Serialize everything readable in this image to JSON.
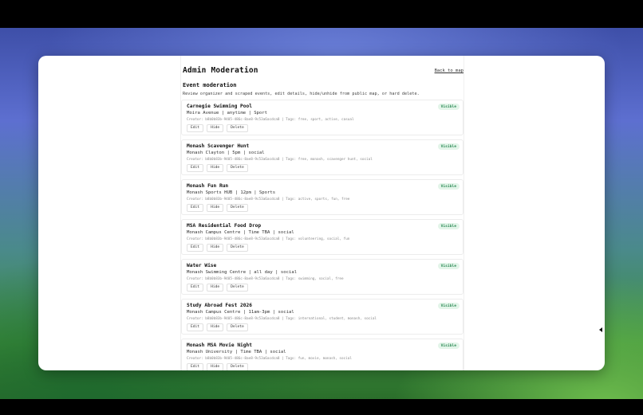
{
  "header": {
    "title": "Admin Moderation",
    "back_link": "Back to map"
  },
  "section": {
    "title": "Event moderation",
    "description": "Review organizer and scraped events, edit details, hide/unhide from public map, or hard delete."
  },
  "actions": {
    "edit": "Edit",
    "hide": "Hide",
    "delete": "Delete"
  },
  "events": [
    {
      "name": "Carnegie Swimming Pool",
      "meta": "Moira Avenue | anytime | Sport",
      "creator": "Creator: b8b0b83b-9405-486c-8ae8-9c53a6acdca8 | Tags: free, sport, active, casual",
      "status": "Visible"
    },
    {
      "name": "Monash Scavenger Hunt",
      "meta": "Monash Clayton | 5pm | social",
      "creator": "Creator: b8b0b83b-9405-486c-8ae8-9c53a6acdca8 | Tags: free, monash, scavenger hunt, social",
      "status": "Visible"
    },
    {
      "name": "Monash Fun Run",
      "meta": "Monash Sports HUB | 12pm | Sports",
      "creator": "Creator: b8b0b83b-9405-486c-8ae8-9c53a6acdca8 | Tags: active, sports, fun, free",
      "status": "Visible"
    },
    {
      "name": "MSA Residential Food Drop",
      "meta": "Monash Campus Centre | Time TBA | social",
      "creator": "Creator: b8b0b83b-9405-486c-8ae8-9c53a6acdca8 | Tags: volunteering, social, fun",
      "status": "Visible"
    },
    {
      "name": "Water Wise",
      "meta": "Monash Swimming Centre | all day | social",
      "creator": "Creator: b8b0b83b-9405-486c-8ae8-9c53a6acdca8 | Tags: swimming, social, free",
      "status": "Visible"
    },
    {
      "name": "Study Abroad Fest 2026",
      "meta": "Monash Campus Centre | 11am-3pm | social",
      "creator": "Creator: b8b0b83b-9405-486c-8ae8-9c53a6acdca8 | Tags: international, student, monash, social",
      "status": "Visible"
    },
    {
      "name": "Monash MSA Movie Night",
      "meta": "Monash University | Time TBA | social",
      "creator": "Creator: b8b0b83b-9405-486c-8ae8-9c53a6acdca8 | Tags: fun, movie, monash, social",
      "status": "Visible"
    }
  ]
}
